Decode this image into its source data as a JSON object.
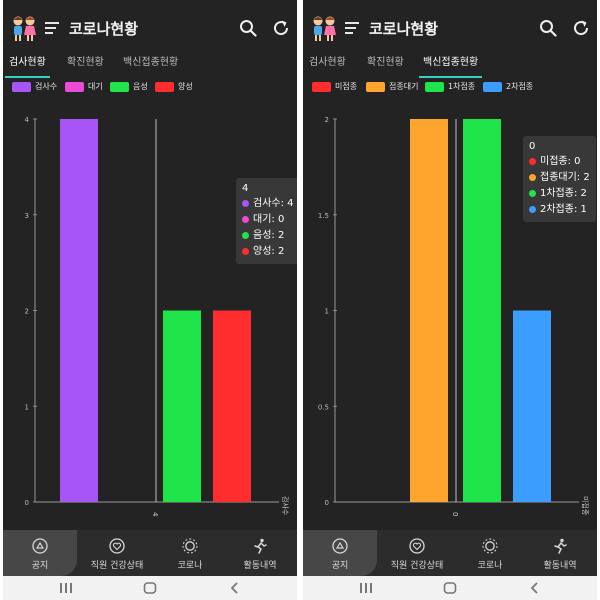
{
  "colors": {
    "purple": "#a855f7",
    "pink": "#ec4bd6",
    "green": "#1fe44a",
    "red": "#ff2d2d",
    "orange": "#ffa52e",
    "blue": "#3b9eff",
    "accent": "#37d1c8"
  },
  "screens": [
    {
      "app_title": "코로나현황",
      "tabs": [
        {
          "label": "검사현황",
          "active": true
        },
        {
          "label": "확진현황",
          "active": false
        },
        {
          "label": "백신접종현황",
          "active": false
        }
      ],
      "legend": [
        {
          "label": "검사수",
          "color": "#a855f7"
        },
        {
          "label": "대기",
          "color": "#ec4bd6"
        },
        {
          "label": "음성",
          "color": "#1fe44a"
        },
        {
          "label": "양성",
          "color": "#ff2d2d"
        }
      ],
      "tooltip": {
        "title": "4",
        "rows": [
          {
            "text": "검사수: 4",
            "color": "#a855f7"
          },
          {
            "text": "대기: 0",
            "color": "#ec4bd6"
          },
          {
            "text": "음성: 2",
            "color": "#1fe44a"
          },
          {
            "text": "양성: 2",
            "color": "#ff2d2d"
          }
        ]
      },
      "bottom_nav": [
        {
          "label": "공지",
          "icon": "notice-icon",
          "active": true
        },
        {
          "label": "직원 건강상태",
          "icon": "heart-icon",
          "active": false
        },
        {
          "label": "코로나",
          "icon": "virus-icon",
          "active": false
        },
        {
          "label": "활동내역",
          "icon": "running-icon",
          "active": false
        }
      ],
      "chart_data": {
        "type": "bar",
        "categories": [
          "4"
        ],
        "series": [
          {
            "name": "검사수",
            "values": [
              4
            ],
            "color": "#a855f7"
          },
          {
            "name": "대기",
            "values": [
              0
            ],
            "color": "#ec4bd6"
          },
          {
            "name": "음성",
            "values": [
              2
            ],
            "color": "#1fe44a"
          },
          {
            "name": "양성",
            "values": [
              2
            ],
            "color": "#ff2d2d"
          }
        ],
        "yticks": [
          "0",
          "1",
          "2",
          "3",
          "4"
        ],
        "ylim": [
          0,
          4
        ],
        "xlabel": "검사수",
        "grid": true
      }
    },
    {
      "app_title": "코로나현황",
      "tabs": [
        {
          "label": "검사현황",
          "active": false
        },
        {
          "label": "확진현황",
          "active": false
        },
        {
          "label": "백신접종현황",
          "active": true
        }
      ],
      "legend": [
        {
          "label": "미접종",
          "color": "#ff2d2d"
        },
        {
          "label": "접종대기",
          "color": "#ffa52e"
        },
        {
          "label": "1차접종",
          "color": "#1fe44a"
        },
        {
          "label": "2차접종",
          "color": "#3b9eff"
        }
      ],
      "tooltip": {
        "title": "0",
        "rows": [
          {
            "text": "미접종: 0",
            "color": "#ff2d2d"
          },
          {
            "text": "접종대기: 2",
            "color": "#ffa52e"
          },
          {
            "text": "1차접종: 2",
            "color": "#1fe44a"
          },
          {
            "text": "2차접종: 1",
            "color": "#3b9eff"
          }
        ]
      },
      "bottom_nav": [
        {
          "label": "공지",
          "icon": "notice-icon",
          "active": true
        },
        {
          "label": "직원 건강상태",
          "icon": "heart-icon",
          "active": false
        },
        {
          "label": "코로나",
          "icon": "virus-icon",
          "active": false
        },
        {
          "label": "활동내역",
          "icon": "running-icon",
          "active": false
        }
      ],
      "chart_data": {
        "type": "bar",
        "categories": [
          "0"
        ],
        "series": [
          {
            "name": "미접종",
            "values": [
              0
            ],
            "color": "#ff2d2d"
          },
          {
            "name": "접종대기",
            "values": [
              2
            ],
            "color": "#ffa52e"
          },
          {
            "name": "1차접종",
            "values": [
              2
            ],
            "color": "#1fe44a"
          },
          {
            "name": "2차접종",
            "values": [
              1
            ],
            "color": "#3b9eff"
          }
        ],
        "yticks": [
          "0",
          "0.5",
          "1",
          "1.5",
          "2"
        ],
        "ylim": [
          0,
          2
        ],
        "xlabel": "미접종",
        "grid": true
      }
    }
  ]
}
